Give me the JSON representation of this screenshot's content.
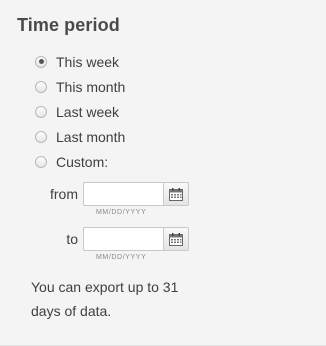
{
  "title": "Time period",
  "options": [
    {
      "label": "This week",
      "checked": true
    },
    {
      "label": "This month",
      "checked": false
    },
    {
      "label": "Last week",
      "checked": false
    },
    {
      "label": "Last month",
      "checked": false
    },
    {
      "label": "Custom:",
      "checked": false
    }
  ],
  "from": {
    "label": "from",
    "value": "",
    "hint": "MM/DD/YYYY"
  },
  "to": {
    "label": "to",
    "value": "",
    "hint": "MM/DD/YYYY"
  },
  "note": "You can export up to 31 days of data.",
  "icons": {
    "calendar": "calendar-icon"
  },
  "colors": {
    "background": "#f4f4f4",
    "text": "#3f3f3f",
    "border": "#c9c9c9"
  }
}
